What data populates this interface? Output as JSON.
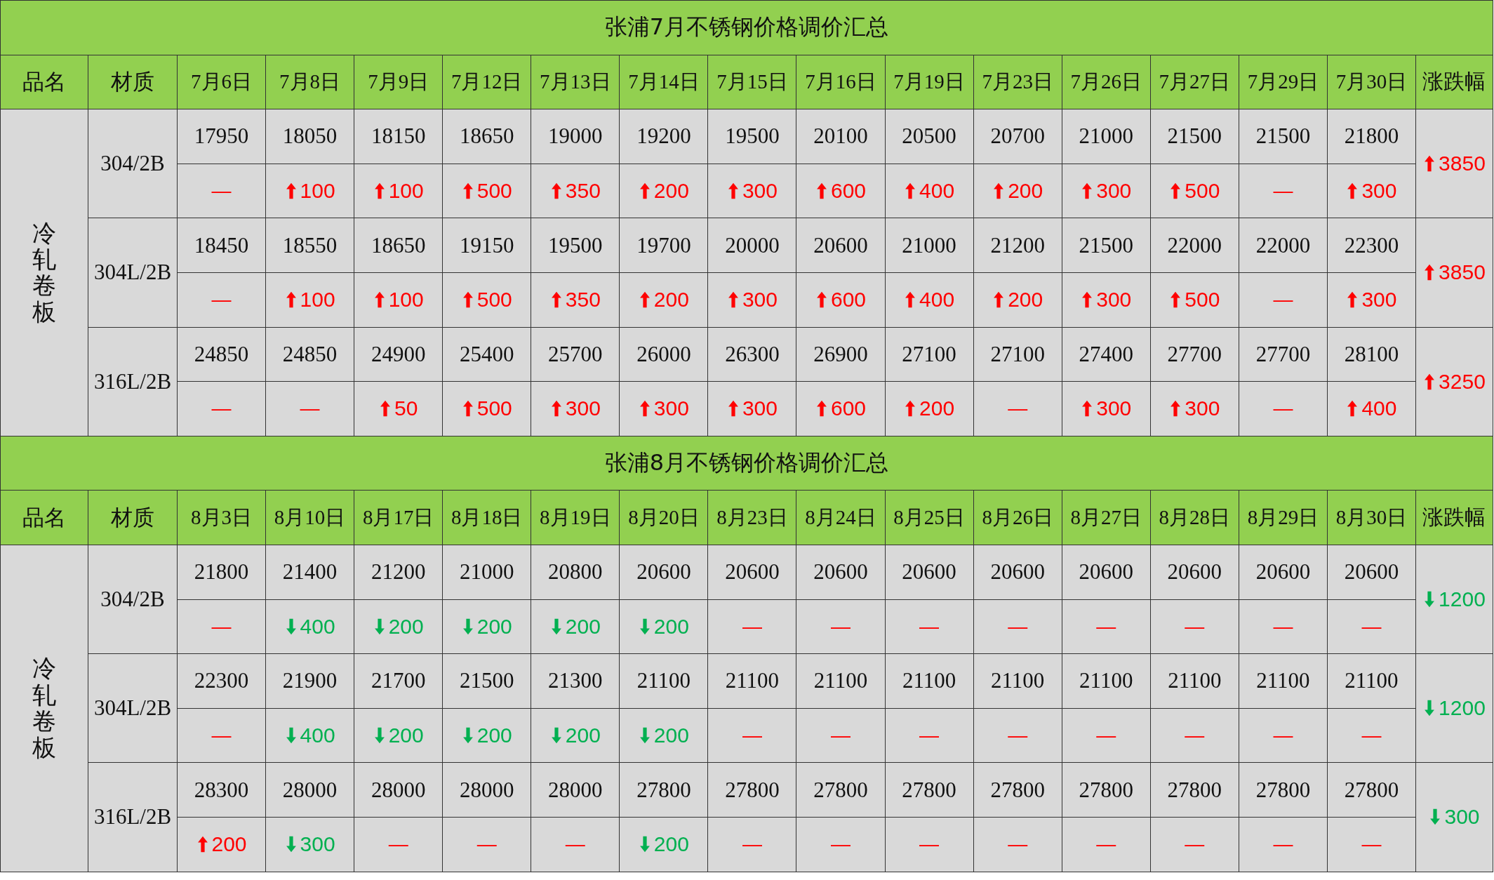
{
  "blocks": [
    {
      "title": "张浦7月不锈钢价格调价汇总",
      "header": {
        "name": "品名",
        "material": "材质",
        "dates": [
          "7月6日",
          "7月8日",
          "7月9日",
          "7月12日",
          "7月13日",
          "7月14日",
          "7月15日",
          "7月16日",
          "7月19日",
          "7月23日",
          "7月26日",
          "7月27日",
          "7月29日",
          "7月30日"
        ],
        "change": "涨跌幅"
      },
      "category": "冷轧卷板",
      "materials": [
        {
          "name": "304/2B",
          "prices": [
            "17950",
            "18050",
            "18150",
            "18650",
            "19000",
            "19200",
            "19500",
            "20100",
            "20500",
            "20700",
            "21000",
            "21500",
            "21500",
            "21800"
          ],
          "changes": [
            {
              "kind": "none",
              "value": "—"
            },
            {
              "kind": "up",
              "value": "100"
            },
            {
              "kind": "up",
              "value": "100"
            },
            {
              "kind": "up",
              "value": "500"
            },
            {
              "kind": "up",
              "value": "350"
            },
            {
              "kind": "up",
              "value": "200"
            },
            {
              "kind": "up",
              "value": "300"
            },
            {
              "kind": "up",
              "value": "600"
            },
            {
              "kind": "up",
              "value": "400"
            },
            {
              "kind": "up",
              "value": "200"
            },
            {
              "kind": "up",
              "value": "300"
            },
            {
              "kind": "up",
              "value": "500"
            },
            {
              "kind": "none",
              "value": "—"
            },
            {
              "kind": "up",
              "value": "300"
            }
          ],
          "total": {
            "kind": "up",
            "value": "3850"
          }
        },
        {
          "name": "304L/2B",
          "prices": [
            "18450",
            "18550",
            "18650",
            "19150",
            "19500",
            "19700",
            "20000",
            "20600",
            "21000",
            "21200",
            "21500",
            "22000",
            "22000",
            "22300"
          ],
          "changes": [
            {
              "kind": "none",
              "value": "—"
            },
            {
              "kind": "up",
              "value": "100"
            },
            {
              "kind": "up",
              "value": "100"
            },
            {
              "kind": "up",
              "value": "500"
            },
            {
              "kind": "up",
              "value": "350"
            },
            {
              "kind": "up",
              "value": "200"
            },
            {
              "kind": "up",
              "value": "300"
            },
            {
              "kind": "up",
              "value": "600"
            },
            {
              "kind": "up",
              "value": "400"
            },
            {
              "kind": "up",
              "value": "200"
            },
            {
              "kind": "up",
              "value": "300"
            },
            {
              "kind": "up",
              "value": "500"
            },
            {
              "kind": "none",
              "value": "—"
            },
            {
              "kind": "up",
              "value": "300"
            }
          ],
          "total": {
            "kind": "up",
            "value": "3850"
          }
        },
        {
          "name": "316L/2B",
          "prices": [
            "24850",
            "24850",
            "24900",
            "25400",
            "25700",
            "26000",
            "26300",
            "26900",
            "27100",
            "27100",
            "27400",
            "27700",
            "27700",
            "28100"
          ],
          "changes": [
            {
              "kind": "none",
              "value": "—"
            },
            {
              "kind": "none",
              "value": "—"
            },
            {
              "kind": "up",
              "value": "50"
            },
            {
              "kind": "up",
              "value": "500"
            },
            {
              "kind": "up",
              "value": "300"
            },
            {
              "kind": "up",
              "value": "300"
            },
            {
              "kind": "up",
              "value": "300"
            },
            {
              "kind": "up",
              "value": "600"
            },
            {
              "kind": "up",
              "value": "200"
            },
            {
              "kind": "none",
              "value": "—"
            },
            {
              "kind": "up",
              "value": "300"
            },
            {
              "kind": "up",
              "value": "300"
            },
            {
              "kind": "none",
              "value": "—"
            },
            {
              "kind": "up",
              "value": "400"
            }
          ],
          "total": {
            "kind": "up",
            "value": "3250"
          }
        }
      ]
    },
    {
      "title": "张浦8月不锈钢价格调价汇总",
      "header": {
        "name": "品名",
        "material": "材质",
        "dates": [
          "8月3日",
          "8月10日",
          "8月17日",
          "8月18日",
          "8月19日",
          "8月20日",
          "8月23日",
          "8月24日",
          "8月25日",
          "8月26日",
          "8月27日",
          "8月28日",
          "8月29日",
          "8月30日"
        ],
        "change": "涨跌幅"
      },
      "category": "冷轧卷板",
      "materials": [
        {
          "name": "304/2B",
          "prices": [
            "21800",
            "21400",
            "21200",
            "21000",
            "20800",
            "20600",
            "20600",
            "20600",
            "20600",
            "20600",
            "20600",
            "20600",
            "20600",
            "20600"
          ],
          "changes": [
            {
              "kind": "none",
              "value": "—"
            },
            {
              "kind": "down",
              "value": "400"
            },
            {
              "kind": "down",
              "value": "200"
            },
            {
              "kind": "down",
              "value": "200"
            },
            {
              "kind": "down",
              "value": "200"
            },
            {
              "kind": "down",
              "value": "200"
            },
            {
              "kind": "none",
              "value": "—"
            },
            {
              "kind": "none",
              "value": "—"
            },
            {
              "kind": "none",
              "value": "—"
            },
            {
              "kind": "none",
              "value": "—"
            },
            {
              "kind": "none",
              "value": "—"
            },
            {
              "kind": "none",
              "value": "—"
            },
            {
              "kind": "none",
              "value": "—"
            },
            {
              "kind": "none",
              "value": "—"
            }
          ],
          "total": {
            "kind": "down",
            "value": "1200"
          }
        },
        {
          "name": "304L/2B",
          "prices": [
            "22300",
            "21900",
            "21700",
            "21500",
            "21300",
            "21100",
            "21100",
            "21100",
            "21100",
            "21100",
            "21100",
            "21100",
            "21100",
            "21100"
          ],
          "changes": [
            {
              "kind": "none",
              "value": "—"
            },
            {
              "kind": "down",
              "value": "400"
            },
            {
              "kind": "down",
              "value": "200"
            },
            {
              "kind": "down",
              "value": "200"
            },
            {
              "kind": "down",
              "value": "200"
            },
            {
              "kind": "down",
              "value": "200"
            },
            {
              "kind": "none",
              "value": "—"
            },
            {
              "kind": "none",
              "value": "—"
            },
            {
              "kind": "none",
              "value": "—"
            },
            {
              "kind": "none",
              "value": "—"
            },
            {
              "kind": "none",
              "value": "—"
            },
            {
              "kind": "none",
              "value": "—"
            },
            {
              "kind": "none",
              "value": "—"
            },
            {
              "kind": "none",
              "value": "—"
            }
          ],
          "total": {
            "kind": "down",
            "value": "1200"
          }
        },
        {
          "name": "316L/2B",
          "prices": [
            "28300",
            "28000",
            "28000",
            "28000",
            "28000",
            "27800",
            "27800",
            "27800",
            "27800",
            "27800",
            "27800",
            "27800",
            "27800",
            "27800"
          ],
          "changes": [
            {
              "kind": "up",
              "value": "200"
            },
            {
              "kind": "down",
              "value": "300"
            },
            {
              "kind": "none",
              "value": "—"
            },
            {
              "kind": "none",
              "value": "—"
            },
            {
              "kind": "none",
              "value": "—"
            },
            {
              "kind": "down",
              "value": "200"
            },
            {
              "kind": "none",
              "value": "—"
            },
            {
              "kind": "none",
              "value": "—"
            },
            {
              "kind": "none",
              "value": "—"
            },
            {
              "kind": "none",
              "value": "—"
            },
            {
              "kind": "none",
              "value": "—"
            },
            {
              "kind": "none",
              "value": "—"
            },
            {
              "kind": "none",
              "value": "—"
            },
            {
              "kind": "none",
              "value": "—"
            }
          ],
          "total": {
            "kind": "down",
            "value": "300"
          }
        }
      ]
    }
  ]
}
